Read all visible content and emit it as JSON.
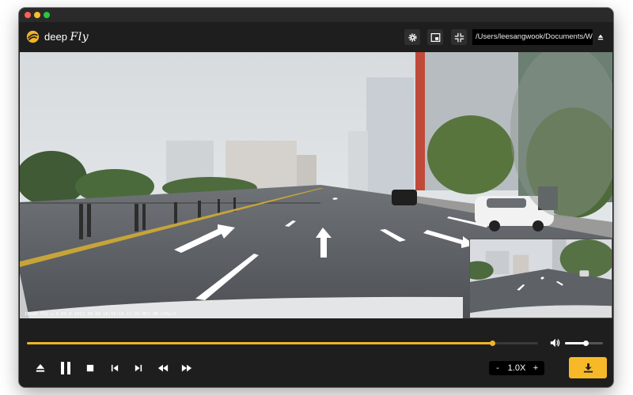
{
  "app": {
    "logo_prefix": "deep",
    "logo_suffix": "Fly"
  },
  "header": {
    "file_path": "/Users/leesangwook/Documents/Work/",
    "buttons": {
      "settings_icon": "gear-icon",
      "pip_icon": "picture-in-picture-icon",
      "exit_fullscreen_icon": "collapse-arrows-icon",
      "path_menu_icon": "eject-icon"
    }
  },
  "video": {
    "overlay_text": "IROAD FX2    v.0.03.0    2022.08.08 10:59:16    12.9V  MIC ON  22Km/h"
  },
  "playback": {
    "progress": 0.91,
    "volume": 0.55,
    "speed_label": "1.0X",
    "speed_minus": "-",
    "speed_plus": "+",
    "buttons": [
      "eject-icon",
      "pause-icon",
      "stop-icon",
      "skip-back-icon",
      "skip-forward-icon",
      "rewind-icon",
      "fast-forward-icon"
    ],
    "download_icon": "download-icon"
  },
  "colors": {
    "accent": "#f0b429",
    "window_bg": "#1e1e1e",
    "download_bg": "#f7b928"
  }
}
